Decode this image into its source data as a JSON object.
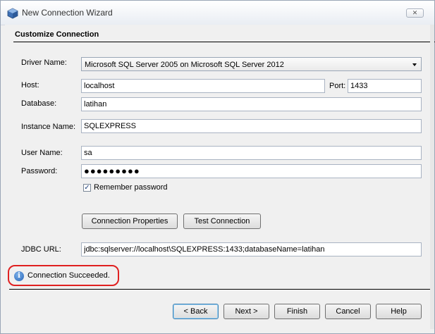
{
  "window": {
    "title": "New Connection Wizard",
    "close_symbol": "✕",
    "app_icon": "netbeans-cube-icon"
  },
  "section": {
    "title": "Customize Connection"
  },
  "form": {
    "driver_label": "Driver Name:",
    "driver_value": "Microsoft SQL Server 2005 on Microsoft SQL Server 2012",
    "host_label": "Host:",
    "host_value": "localhost",
    "port_label": "Port:",
    "port_value": "1433",
    "database_label": "Database:",
    "database_value": "latihan",
    "instance_label": "Instance Name:",
    "instance_value": "SQLEXPRESS",
    "user_label": "User Name:",
    "user_value": "sa",
    "password_label": "Password:",
    "password_mask": "●●●●●●●●●",
    "remember_label": "Remember password",
    "remember_checked": true,
    "check_mark": "✓",
    "conn_props_button": "Connection Properties",
    "test_conn_button": "Test Connection",
    "jdbc_label": "JDBC URL:",
    "jdbc_value": "jdbc:sqlserver://localhost\\SQLEXPRESS:1433;databaseName=latihan"
  },
  "status": {
    "icon_glyph": "i",
    "message": "Connection Succeeded."
  },
  "footer": {
    "back": "< Back",
    "next": "Next >",
    "finish": "Finish",
    "cancel": "Cancel",
    "help": "Help"
  },
  "colors": {
    "highlight_outline": "#e02020",
    "info_icon": "#2563b8"
  }
}
